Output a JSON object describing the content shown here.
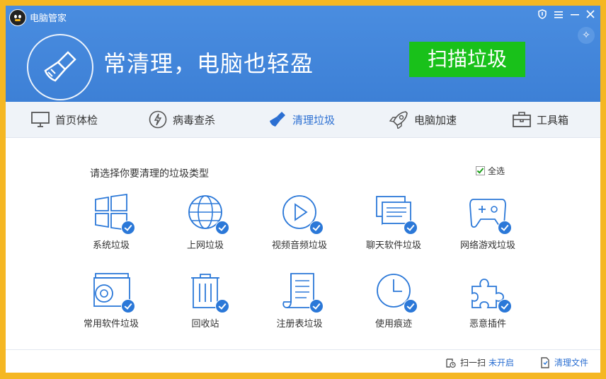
{
  "window": {
    "title": "电脑管家"
  },
  "header": {
    "headline": "常清理，电脑也轻盈",
    "scan_button": "扫描垃圾"
  },
  "tabs": [
    {
      "label": "首页体检",
      "icon": "monitor-icon"
    },
    {
      "label": "病毒查杀",
      "icon": "lightning-icon"
    },
    {
      "label": "清理垃圾",
      "icon": "broom-icon",
      "active": true
    },
    {
      "label": "电脑加速",
      "icon": "rocket-icon"
    },
    {
      "label": "工具箱",
      "icon": "toolbox-icon"
    }
  ],
  "main": {
    "prompt": "请选择你要清理的垃圾类型",
    "select_all": "全选",
    "items": [
      {
        "label": "系统垃圾",
        "icon": "windows-icon"
      },
      {
        "label": "上网垃圾",
        "icon": "globe-icon"
      },
      {
        "label": "视频音频垃圾",
        "icon": "play-icon"
      },
      {
        "label": "聊天软件垃圾",
        "icon": "chat-icon"
      },
      {
        "label": "网络游戏垃圾",
        "icon": "gamepad-icon"
      },
      {
        "label": "常用软件垃圾",
        "icon": "disc-drive-icon"
      },
      {
        "label": "回收站",
        "icon": "trash-icon"
      },
      {
        "label": "注册表垃圾",
        "icon": "document-icon"
      },
      {
        "label": "使用痕迹",
        "icon": "clock-icon"
      },
      {
        "label": "恶意插件",
        "icon": "puzzle-icon"
      }
    ]
  },
  "footer": {
    "schedule_text": "扫一扫",
    "schedule_link": "未开启",
    "clean_files": "清理文件"
  },
  "colors": {
    "accent": "#3d80d6",
    "scan_button": "#19c11a",
    "outer_bg": "#f5b723"
  }
}
